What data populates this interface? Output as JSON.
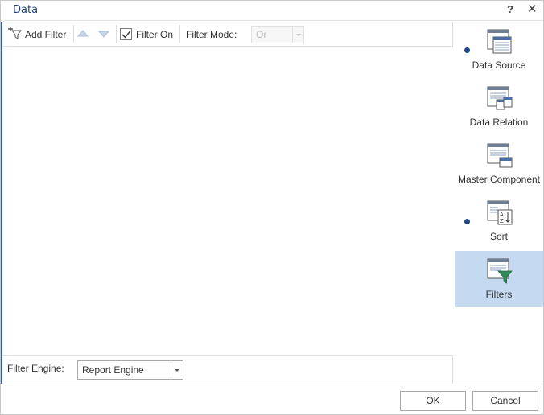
{
  "dialog": {
    "title": "Data",
    "help_label": "?",
    "close_label": "✕"
  },
  "toolbar": {
    "add_filter_label": "Add Filter",
    "filter_on_label": "Filter On",
    "filter_on_checked": true,
    "filter_mode_label": "Filter Mode:",
    "filter_mode_value": "Or"
  },
  "footer": {
    "engine_label": "Filter Engine:",
    "engine_value": "Report Engine"
  },
  "nav": {
    "items": [
      {
        "label": "Data Source",
        "icon": "data-source-icon",
        "has_dot": true,
        "active": false
      },
      {
        "label": "Data Relation",
        "icon": "data-relation-icon",
        "has_dot": false,
        "active": false
      },
      {
        "label": "Master Component",
        "icon": "master-component-icon",
        "has_dot": false,
        "active": false
      },
      {
        "label": "Sort",
        "icon": "sort-icon",
        "has_dot": true,
        "active": false
      },
      {
        "label": "Filters",
        "icon": "filters-icon",
        "has_dot": false,
        "active": true
      }
    ]
  },
  "buttons": {
    "ok_label": "OK",
    "cancel_label": "Cancel"
  },
  "colors": {
    "accent": "#1c3f7a",
    "active_nav_bg": "#c5d9f1",
    "dot": "#1e4586",
    "filter_green": "#2e8b57"
  }
}
